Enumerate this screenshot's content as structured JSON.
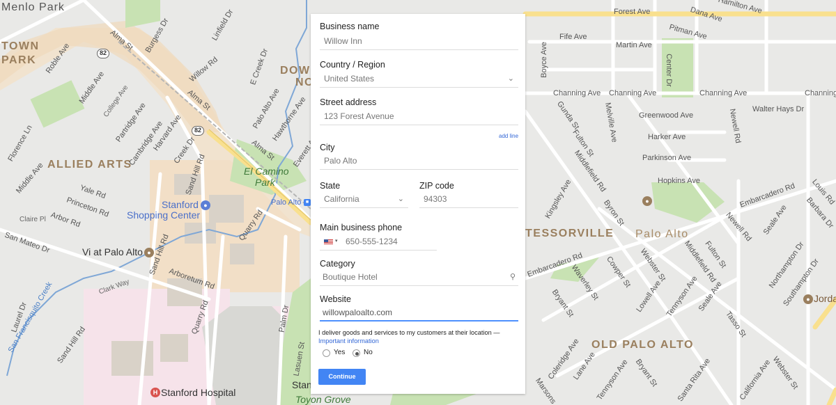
{
  "form": {
    "business_name": {
      "label": "Business name",
      "value": "Willow Inn"
    },
    "country": {
      "label": "Country / Region",
      "value": "United States"
    },
    "street": {
      "label": "Street address",
      "value": "123 Forest Avenue",
      "add_line": "add line"
    },
    "city": {
      "label": "City",
      "value": "Palo Alto"
    },
    "state": {
      "label": "State",
      "value": "California"
    },
    "zip": {
      "label": "ZIP code",
      "value": "94303"
    },
    "phone": {
      "label": "Main business phone",
      "value": "650-555-1234"
    },
    "category": {
      "label": "Category",
      "value": "Boutique Hotel"
    },
    "website": {
      "label": "Website",
      "value": "willowpaloalto.com"
    },
    "delivery_question": "I deliver goods and services to my customers at their location —",
    "important_link": "Important information",
    "options": {
      "yes": "Yes",
      "no": "No",
      "selected": "no"
    },
    "continue_label": "Continue"
  },
  "map": {
    "neighborhoods": [
      "Menlo Park",
      "TOWN",
      "PARK",
      "ALLIED ARTS",
      "DOWN",
      "NO",
      "TESSORVILLE",
      "Palo Alto",
      "OLD PALO ALTO"
    ],
    "parks": [
      "El Camino",
      "Park"
    ],
    "pois": {
      "stanford_shopping": [
        "Stanford",
        "Shopping Center"
      ],
      "vi_palo_alto": "Vi at Palo Alto",
      "stanford_hospital": "Stanford Hospital",
      "palo_alto_station": "Palo Alto",
      "jorda": "Jorda",
      "stan": "Stan",
      "toyon": "Toyon Grove"
    },
    "routes": [
      "82",
      "82"
    ],
    "streets": {
      "alma_st_1": "Alma St",
      "burgess_dr": "Burgess Dr",
      "linfield_dr": "Linfield Dr",
      "roble_ave": "Roble Ave",
      "willow_rd": "Willow Rd",
      "e_creek_dr": "E Creek Dr",
      "alma_st_2": "Alma St",
      "middle_ave_1": "Middle Ave",
      "college_ave": "College Ave",
      "partridge_ave": "Partridge Ave",
      "cambridge_ave": "Cambridge Ave",
      "harvard_ave": "Harvard Ave",
      "creek_dr": "Creek Dr",
      "sand_hill_rd_1": "Sand Hill Rd",
      "florence_ln": "Florence Ln",
      "palo_alto_ave": "Palo Alto Ave",
      "hawthorne_ave": "Hawthorne Ave",
      "everett_ave": "Everett Ave",
      "alma_st_3": "Alma St",
      "middle_ave_2": "Middle Ave",
      "yale_rd": "Yale Rd",
      "princeton_rd": "Princeton Rd",
      "arbor_rd": "Arbor Rd",
      "san_mateo_dr": "San Mateo Dr",
      "claire_pl": "Claire Pl",
      "quarry_rd_1": "Quarry Rd",
      "sand_hill_rd_2": "Sand Hill Rd",
      "arboretum_rd": "Arboretum Rd",
      "clark_way": "Clark Way",
      "san_francisquito_creek": "San Francisquito Creek",
      "laurel_dr": "Laurel Dr",
      "sand_hill_rd_3": "Sand Hill Rd",
      "quarry_rd_2": "Quarry Rd",
      "palm_dr": "Palm Dr",
      "lasuen_st": "Lasuen St",
      "forest_ave": "Forest Ave",
      "dana_ave": "Dana Ave",
      "hamilton_ave": "Hamilton Ave",
      "fife_ave": "Fife Ave",
      "pitman_ave": "Pitman Ave",
      "martin_ave": "Martin Ave",
      "boyce_ave": "Boyce Ave",
      "center_dr": "Center Dr",
      "channing_ave_1": "Channing Ave",
      "channing_ave_2": "Channing Ave",
      "channing_ave_3": "Channing Ave",
      "channing_ave_4": "Channing",
      "gunda_st": "Gunda St",
      "melville_ave": "Melville Ave",
      "newell_rd_1": "Newell Rd",
      "walter_hays_dr": "Walter Hays Dr",
      "fulton_st_1": "Fulton St",
      "greenwood_ave": "Greenwood Ave",
      "harker_ave": "Harker Ave",
      "parkinson_ave": "Parkinson Ave",
      "hopkins_ave": "Hopkins Ave",
      "middlefield_rd_1": "Middlefield Rd",
      "kingsley_ave": "Kingsley Ave",
      "byron_st": "Byron St",
      "embarcadero_rd_1": "Embarcadero Rd",
      "newell_rd_2": "Newell Rd",
      "seale_ave_1": "Seale Ave",
      "barbara_dr": "Barbara Dr",
      "louis_rd": "Louis Rd",
      "northampton_dr": "Northampton Dr",
      "southampton_dr": "Southampton Dr",
      "embarcadero_rd_2": "Embarcadero Rd",
      "cowper_st": "Cowper St",
      "webster_st_1": "Webster St",
      "middlefield_rd_2": "Middlefield Rd",
      "fulton_st_2": "Fulton St",
      "waverley_st": "Waverley St",
      "bryant_st": "Bryant St",
      "lowell_ave": "Lowell Ave",
      "tennyson_ave_1": "Tennyson Ave",
      "seale_ave_2": "Seale Ave",
      "tasso_st": "Tasso St",
      "coleridge_ave": "Coleridge Ave",
      "lane_ave": "Lane Ave",
      "tennyson_ave_2": "Tennyson Ave",
      "bryant_st_2": "Bryant St",
      "santa_rita_ave": "Santa Rita Ave",
      "california_ave": "California Ave",
      "webster_st_2": "Webster St",
      "marsons": "Marsons"
    }
  }
}
